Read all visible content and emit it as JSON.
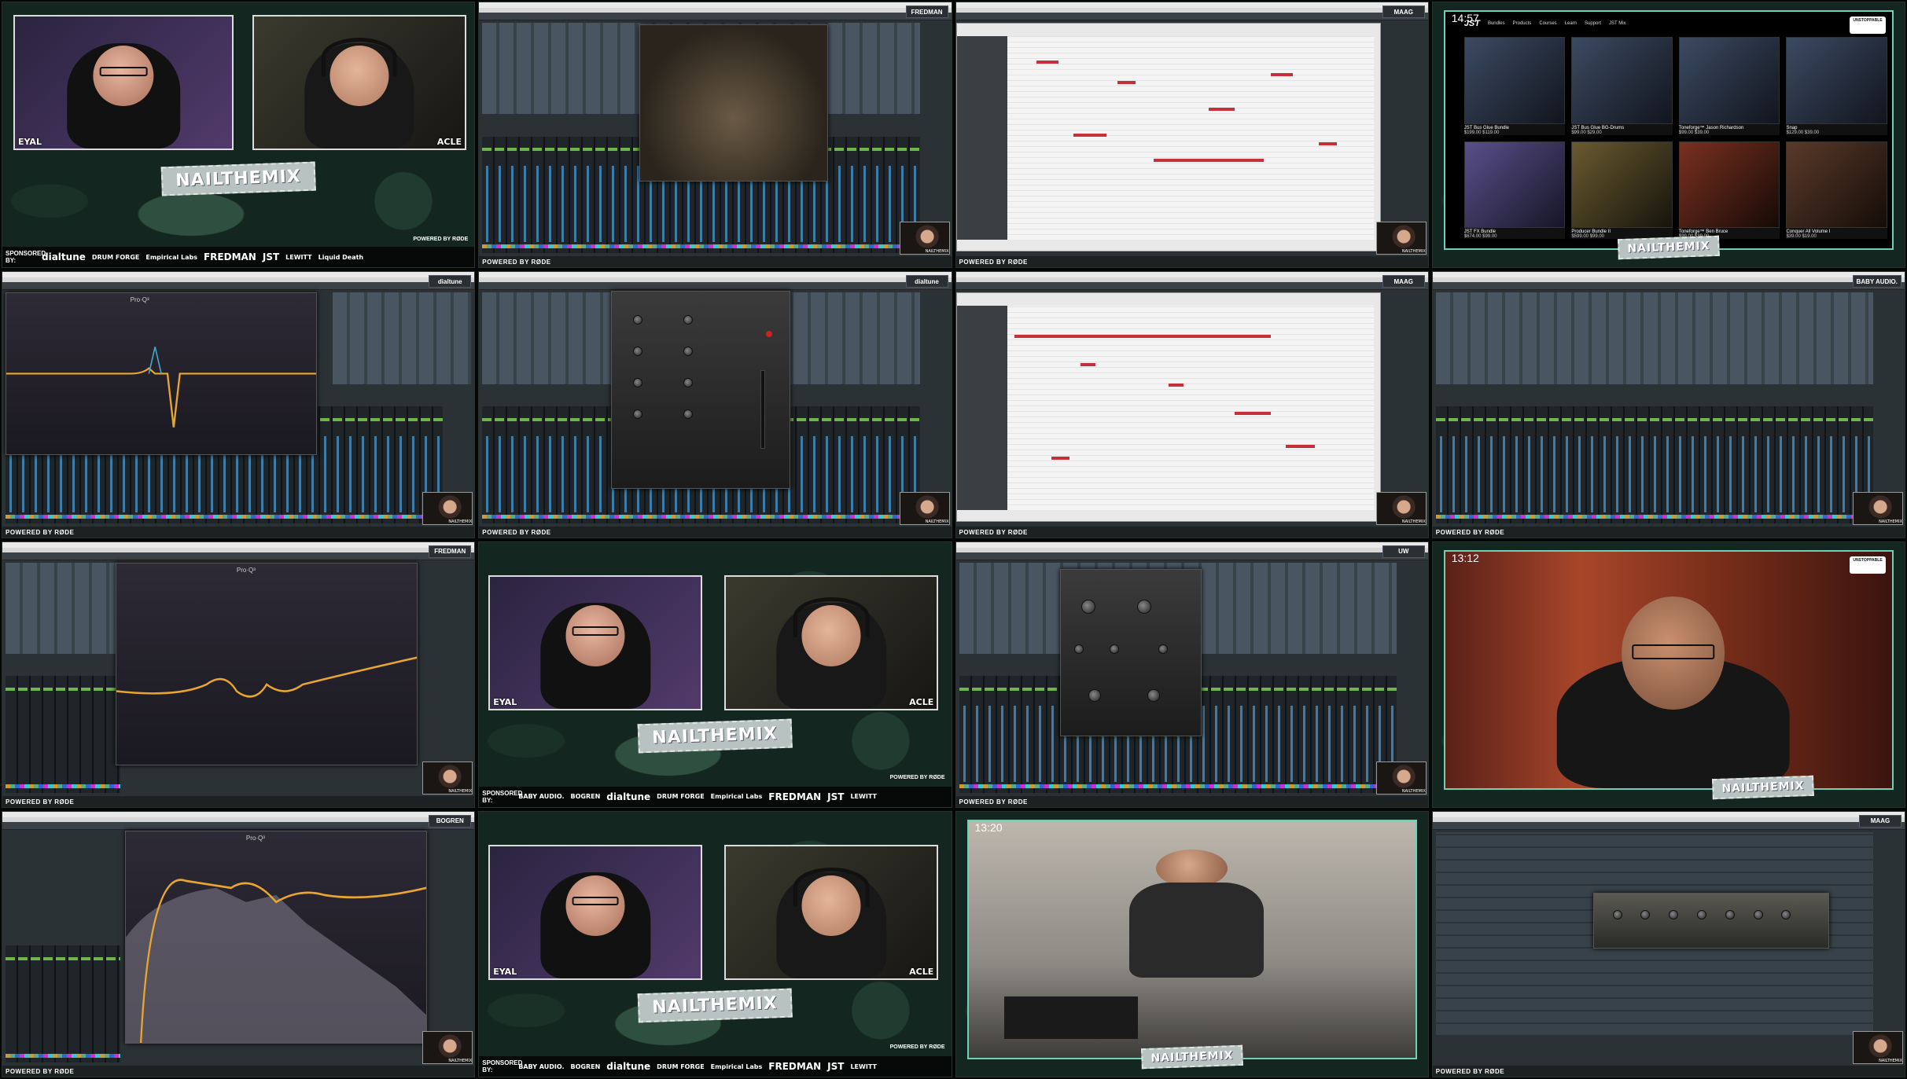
{
  "brand": {
    "show_logo": "NAILTHEMIX",
    "powered_by": "POWERED BY RØDE",
    "sponsored_by": "SPONSORED BY:"
  },
  "hosts": {
    "left": "EYAL",
    "right": "ACLE"
  },
  "sponsors_row1": [
    "dialtune",
    "DRUM FORGE",
    "Empirical Labs",
    "FREDMAN",
    "JST",
    "LEWITT",
    "Liquid Death"
  ],
  "sponsors_row2": [
    "BABY AUDIO.",
    "BOGREN",
    "dialtune",
    "DRUM FORGE",
    "Empirical Labs",
    "FREDMAN",
    "JST",
    "LEWITT"
  ],
  "tile_sponsor_tags": {
    "t2": "FREDMAN",
    "t3": "MAAG",
    "t5": "dialtune",
    "t6": "dialtune",
    "t7": "MAAG",
    "t8": "BABY AUDIO.",
    "t9": "FREDMAN",
    "t11": "UW",
    "t13": "BOGREN",
    "t16": "MAAG"
  },
  "pip_label": "NAILTHEMIX",
  "timers": {
    "store": "14:57",
    "guest": "13:12",
    "studio": "13:20"
  },
  "plugins": {
    "proq": "Pro·Q³"
  },
  "store": {
    "logo": "JST",
    "nav": [
      "Bundles",
      "Products",
      "Courses",
      "Learn",
      "Support",
      "JST Mix"
    ],
    "badge": "UNSTOPPABLE",
    "items": [
      {
        "name": "JST Bus Glue Bundle",
        "price": "$199.00 $119.00"
      },
      {
        "name": "JST Bus Glue BG-Drums",
        "price": "$99.00 $29.00"
      },
      {
        "name": "Toneforge™ Jason Richardson",
        "price": "$99.00 $39.00"
      },
      {
        "name": "Snap",
        "price": "$129.00 $39.00"
      },
      {
        "name": "JST FX Bundle",
        "price": "$674.00 $99.00"
      },
      {
        "name": "Producer Bundle II",
        "price": "$599.00 $99.00"
      },
      {
        "name": "Toneforge™ Ben Bruce",
        "price": "$99.00 $39.00"
      },
      {
        "name": "Conquer All Volume I",
        "price": "$39.00 $19.00"
      }
    ]
  }
}
